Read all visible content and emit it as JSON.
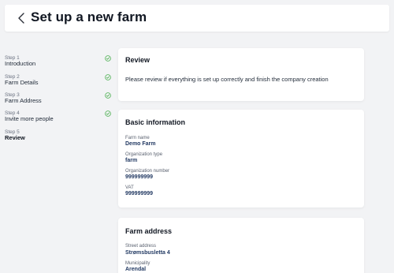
{
  "header": {
    "title": "Set up a new farm",
    "back_icon": "chevron-left-icon"
  },
  "steps": [
    {
      "number": "Step 1",
      "label": "Introduction",
      "completed": true
    },
    {
      "number": "Step 2",
      "label": "Farm Details",
      "completed": true
    },
    {
      "number": "Step 3",
      "label": "Farm Address",
      "completed": true
    },
    {
      "number": "Step 4",
      "label": "Invite more people",
      "completed": true
    },
    {
      "number": "Step 5",
      "label": "Review",
      "completed": false,
      "active": true
    }
  ],
  "review": {
    "title": "Review",
    "text": "Please review if everything is set up correctly and finish the company creation"
  },
  "basic_info": {
    "title": "Basic information",
    "fields": [
      {
        "label": "Farm name",
        "value": "Demo Farm"
      },
      {
        "label": "Organization type",
        "value": "farm"
      },
      {
        "label": "Organization number",
        "value": "999999999"
      },
      {
        "label": "VAT",
        "value": "999999999"
      }
    ]
  },
  "farm_address": {
    "title": "Farm address",
    "fields": [
      {
        "label": "Street address",
        "value": "Strømsbusletta 4"
      },
      {
        "label": "Municipality",
        "value": "Arendal"
      }
    ]
  },
  "colors": {
    "check": "#4caf50",
    "value_text": "#233a63",
    "background": "#f2f3f5"
  }
}
